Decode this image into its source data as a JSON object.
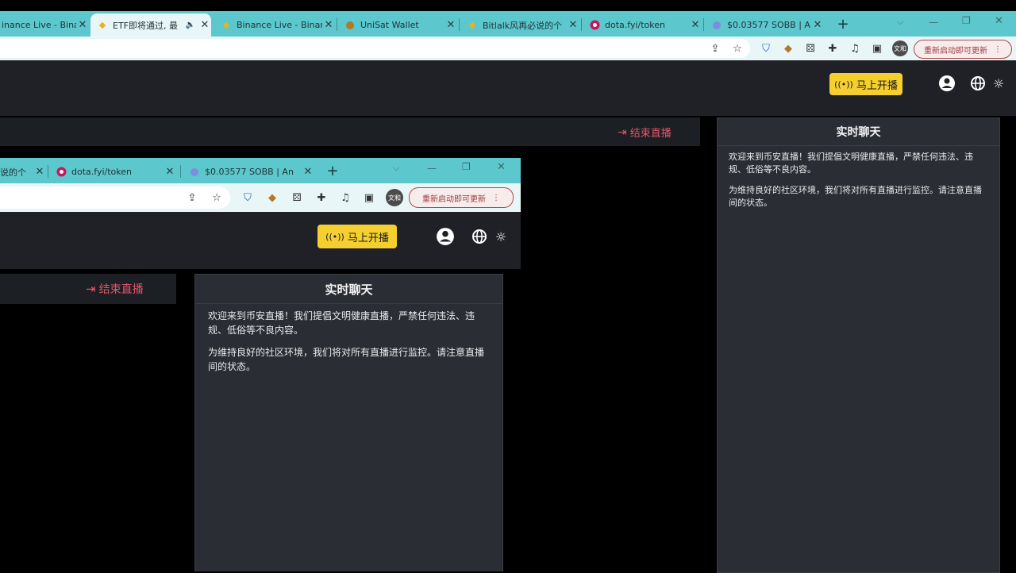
{
  "browser": {
    "tabs": [
      {
        "label": "inance Live - Binan",
        "icon": "binance-icon"
      },
      {
        "label": "ETF即将通过, 最",
        "icon": "binance-icon"
      },
      {
        "label": "Binance Live - Binan",
        "icon": "binance-icon"
      },
      {
        "label": "UniSat Wallet",
        "icon": "unisat-icon"
      },
      {
        "label": "Bitlalk风再必说的个",
        "icon": "binance-icon"
      },
      {
        "label": "dota.fyi/token",
        "icon": "dota-icon"
      },
      {
        "label": "$0.03577 SOBB | An",
        "icon": "globe-icon"
      }
    ],
    "new_tab": "+",
    "restart_label": "重新启动即可更新",
    "profile": "文和"
  },
  "header": {
    "go_live": "马上开播"
  },
  "stream": {
    "end_live": "结束直播"
  },
  "chat": {
    "title": "实时聊天",
    "messages": [
      "欢迎来到币安直播！我们提倡文明健康直播，严禁任何违法、违规、低俗等不良内容。",
      "为维持良好的社区环境，我们将对所有直播进行监控。请注意直播间的状态。"
    ]
  },
  "inner": {
    "tabs": [
      {
        "label": "说的个"
      },
      {
        "label": "dota.fyi/token"
      },
      {
        "label": "$0.03577 SOBB | An"
      }
    ],
    "restart_label": "重新启动即可更新",
    "profile": "文和",
    "go_live": "马上开播",
    "end_live": "结束直播",
    "chat_title": "实时聊天",
    "messages": [
      "欢迎来到币安直播！我们提倡文明健康直播，严禁任何违法、违规、低俗等不良内容。",
      "为维持良好的社区环境，我们将对所有直播进行监控。请注意直播间的状态。"
    ]
  }
}
